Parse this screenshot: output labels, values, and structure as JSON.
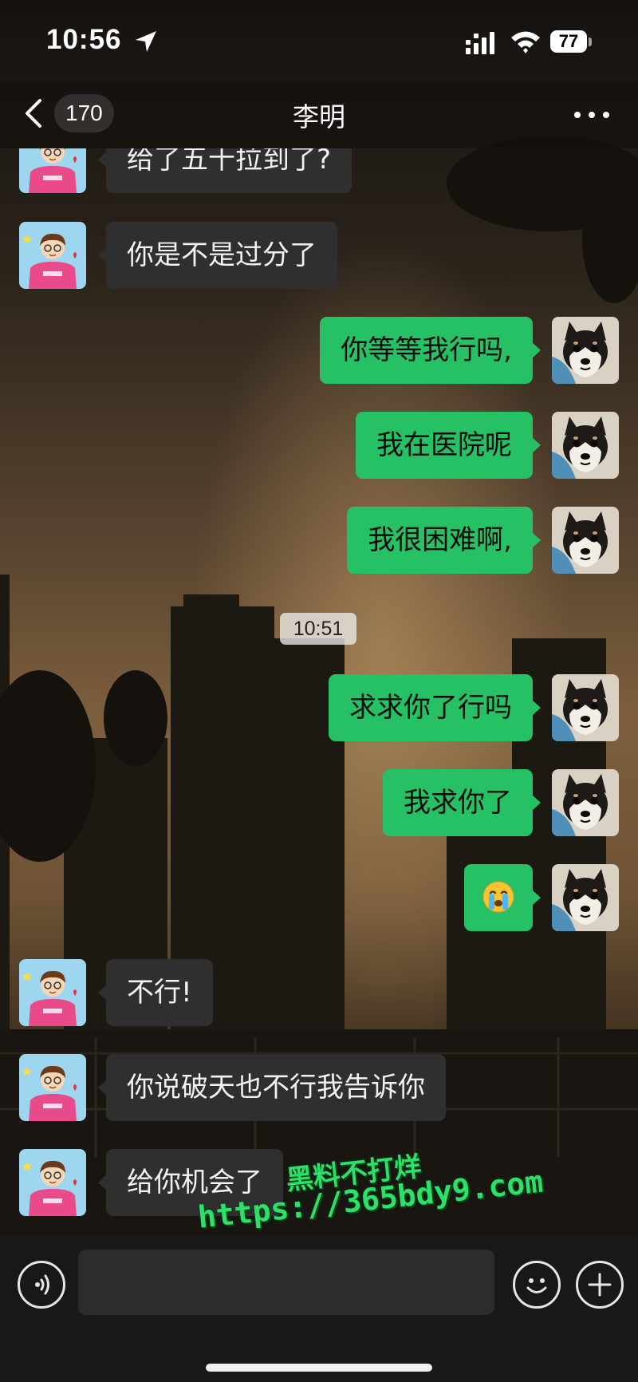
{
  "status_bar": {
    "time": "10:56",
    "battery": "77",
    "icons": [
      "location-arrow-icon",
      "cellular-signal-icon",
      "wifi-icon",
      "battery-icon"
    ]
  },
  "nav": {
    "back_icon": "chevron-left-icon",
    "unread_count": "170",
    "title": "李明",
    "more_icon": "more-dots-icon"
  },
  "messages": [
    {
      "side": "in",
      "text": "给了五十拉到了?"
    },
    {
      "side": "in",
      "text": "你是不是过分了"
    },
    {
      "side": "out",
      "text": "你等等我行吗,"
    },
    {
      "side": "out",
      "text": "我在医院呢"
    },
    {
      "side": "out",
      "text": "我很困难啊,"
    },
    {
      "side": "time",
      "text": "10:51"
    },
    {
      "side": "out",
      "text": "求求你了行吗"
    },
    {
      "side": "out",
      "text": "我求你了"
    },
    {
      "side": "out",
      "emoji": "crying-face-emoji"
    },
    {
      "side": "in",
      "text": "不行!"
    },
    {
      "side": "in",
      "text": "你说破天也不行我告诉你"
    },
    {
      "side": "in",
      "text": "给你机会了"
    }
  ],
  "avatars": {
    "contact": "cartoon-boy-avatar",
    "self": "shiba-dog-avatar"
  },
  "watermark": {
    "title": "黑料不打烊",
    "url": "https://365bdy9.com"
  },
  "input_bar": {
    "voice_icon": "voice-wave-icon",
    "emoji_icon": "smiley-icon",
    "add_icon": "plus-icon",
    "message_value": ""
  },
  "colors": {
    "outgoing_bubble": "#27c165",
    "incoming_bubble": "#2f2f2f",
    "watermark": "#2ee06a"
  }
}
